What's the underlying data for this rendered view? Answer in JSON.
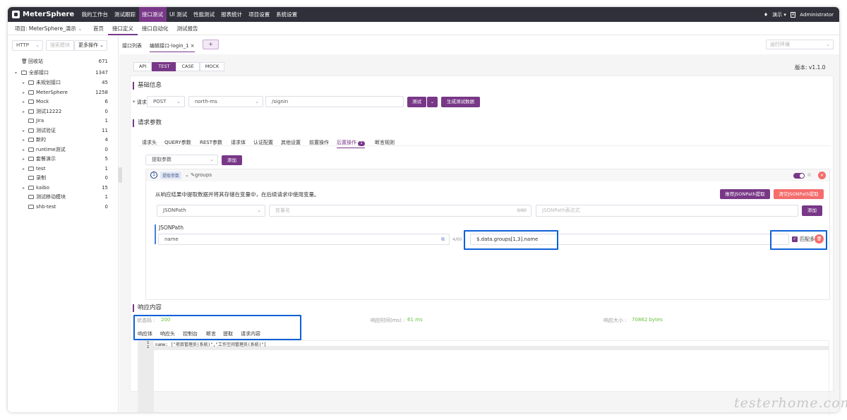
{
  "topnav": {
    "brand": "MeterSphere",
    "items": [
      "我的工作台",
      "测试跟踪",
      "接口测试",
      "UI 测试",
      "性能测试",
      "报表统计",
      "项目设置",
      "系统设置"
    ],
    "active_index": 2,
    "workspace": "演示",
    "user": "Administrator"
  },
  "subnav": {
    "project": "项目: MeterSphere_演示",
    "items": [
      "首页",
      "接口定义",
      "接口自动化",
      "测试报告"
    ],
    "active_index": 1
  },
  "sidebar": {
    "protocol": "HTTP",
    "search_placeholder": "搜索模块",
    "more_ops": "更多操作",
    "trash_label": "回收站",
    "trash_count": "671",
    "root_label": "全部接口",
    "root_count": "1347",
    "nodes": [
      {
        "label": "未规划接口",
        "count": "45"
      },
      {
        "label": "MeterSphere",
        "count": "1258"
      },
      {
        "label": "Mock",
        "count": "6"
      },
      {
        "label": "测试12222",
        "count": "0"
      },
      {
        "label": "Jira",
        "count": "1"
      },
      {
        "label": "测试验证",
        "count": "11"
      },
      {
        "label": "新的",
        "count": "4"
      },
      {
        "label": "runtime测试",
        "count": "0"
      },
      {
        "label": "套餐演示",
        "count": "5"
      },
      {
        "label": "test",
        "count": "1"
      },
      {
        "label": "录制",
        "count": "0"
      },
      {
        "label": "kaibo",
        "count": "15"
      },
      {
        "label": "测试移动模块",
        "count": "1"
      },
      {
        "label": "shb-test",
        "count": "0"
      }
    ]
  },
  "tabs": {
    "list": "接口列表",
    "edit": "编辑接口-login_1",
    "add": "+",
    "env_placeholder": "运行环境"
  },
  "modes": [
    "API",
    "TEST",
    "CASE",
    "MOCK"
  ],
  "mode_active": 1,
  "version": "版本: v1.1.0",
  "basic": {
    "title": "基础信息",
    "required_label": "* 请求",
    "method": "POST",
    "env": "north-ms",
    "path": "/signin",
    "test_btn": "测试",
    "gen_btn": "生成测试数据"
  },
  "params": {
    "title": "请求参数",
    "tabs": [
      "请求头",
      "QUERY参数",
      "REST参数",
      "请求体",
      "认证配置",
      "其他设置",
      "前置操作",
      "后置操作",
      "断言规则"
    ],
    "active_tab": 7,
    "post_badge": "1",
    "extract_select": "提取参数",
    "add_btn": "添加",
    "item": {
      "index": "1",
      "tag": "提取参数",
      "name": "groups",
      "desc": "从响应结果中提取数据并将其存储在变量中，在后续请求中使用变量。",
      "recommend_btn": "推荐JSONPath提取",
      "clear_btn": "清空JSONPath提取",
      "type_select": "JSONPath",
      "var_placeholder": "变量名",
      "var_count": "0/60",
      "expr_placeholder": "JSONPath表达式",
      "add_btn": "添加",
      "sub_label": "JSONPath",
      "row_name": "name",
      "row_count": "4/60",
      "row_expr": "$.data.groups[1,3].name",
      "match_all": "匹配多条"
    }
  },
  "response": {
    "title": "响应内容",
    "status_label": "状态码 :",
    "status": "200",
    "time_label": "响应时间(ms) :",
    "time": "61 ms",
    "size_label": "响应大小 :",
    "size": "70862 bytes",
    "tabs": [
      "响应体",
      "响应头",
      "控制台",
      "断言",
      "提取",
      "请求内容"
    ],
    "line1": "name: [\"项目管理员(系统)\",\"工作空间管理员(系统)\"]",
    "ln1": "1",
    "ln2": "2"
  },
  "watermark": "testerhome.com",
  "colors": {
    "brand": "#783887",
    "nav_bg": "#2f3039",
    "highlight": "#1060d8",
    "red": "#f56c6c",
    "green": "#67c23a"
  }
}
